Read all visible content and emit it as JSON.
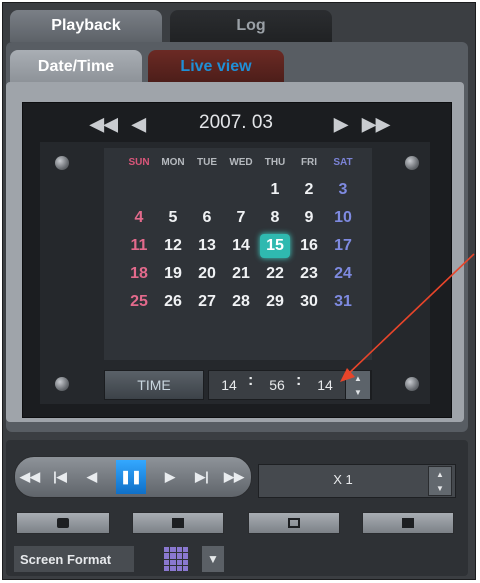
{
  "main_tabs": {
    "playback": "Playback",
    "log": "Log"
  },
  "sub_tabs": {
    "date_time": "Date/Time",
    "live_view": "Live view"
  },
  "calendar": {
    "month_label": "2007. 03",
    "weekdays": [
      "SUN",
      "MON",
      "TUE",
      "WED",
      "THU",
      "FRI",
      "SAT"
    ],
    "weeks": [
      [
        "",
        "",
        "",
        "",
        "1",
        "2",
        "3"
      ],
      [
        "4",
        "5",
        "6",
        "7",
        "8",
        "9",
        "10"
      ],
      [
        "11",
        "12",
        "13",
        "14",
        "15",
        "16",
        "17"
      ],
      [
        "18",
        "19",
        "20",
        "21",
        "22",
        "23",
        "24"
      ],
      [
        "25",
        "26",
        "27",
        "28",
        "29",
        "30",
        "31"
      ]
    ],
    "selected_day": "15"
  },
  "time": {
    "button_label": "TIME",
    "hour": "14",
    "minute": "56",
    "second": "14"
  },
  "playback_speed": "X 1",
  "screen_format_label": "Screen Format",
  "colors": {
    "accent": "#2fb9b0",
    "sunday": "#e36a8c",
    "saturday": "#7e8ae0",
    "arrow": "#e8452a"
  }
}
